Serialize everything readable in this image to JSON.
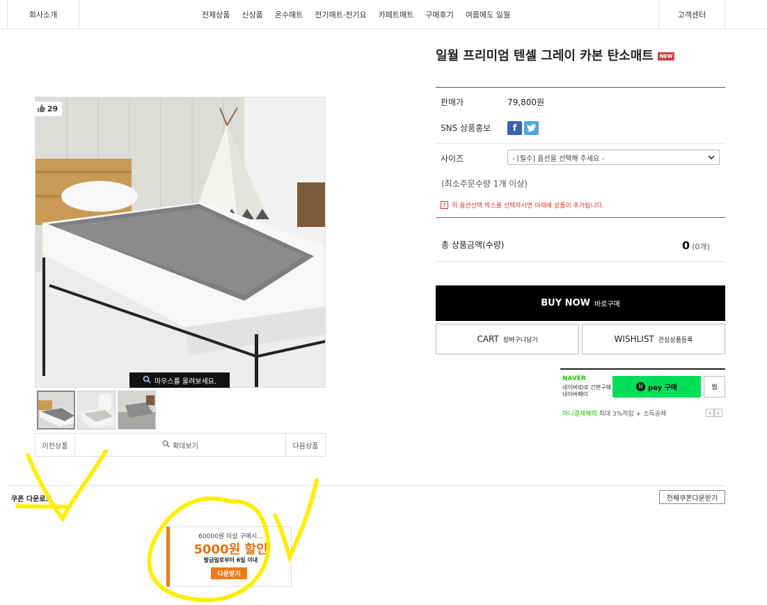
{
  "nav": {
    "company": "회사소개",
    "support": "고객센터",
    "menu": [
      "전체상품",
      "신상품",
      "온수매트",
      "전기매트·전기요",
      "카페트매트",
      "구매후기",
      "여름에도 일월"
    ]
  },
  "product": {
    "title": "일월 프리미엄 텐셀 그레이 카본 탄소매트",
    "new_badge": "NEW",
    "likes": "29",
    "zoom_hint": "마우스를 올려보세요.",
    "prev_label": "이전상품",
    "zoom_label": "확대보기",
    "next_label": "다음상품"
  },
  "info": {
    "price_label": "판매가",
    "price": "79,800원",
    "sns_label": "SNS 상품홍보",
    "size_label": "사이즈",
    "size_placeholder": "- [필수] 옵션을 선택해 주세요 -",
    "min_order": "(최소주문수량 1개 이상)",
    "warning": "위 옵션선택 박스를 선택하시면 아래에 상품이 추가됩니다.",
    "total_label": "총 상품금액(수량)",
    "total_value": "0",
    "total_count": "(0개)"
  },
  "buttons": {
    "buy_en": "BUY NOW",
    "buy_ko": "바로구매",
    "cart_en": "CART",
    "cart_ko": "장바구니담기",
    "wish_en": "WISHLIST",
    "wish_ko": "관심상품등록"
  },
  "naver": {
    "brand": "NAVER",
    "desc1": "네이버ID로 간편구매",
    "desc2": "네이버페이",
    "pay_label": "pay 구매",
    "zzim": "찜",
    "benefit_green": "머니결제혜택",
    "benefit_rest": "최대 3%적립 + 소득공제"
  },
  "coupon": {
    "section_title": "쿠폰 다운로드",
    "all_button": "전체쿠폰다운받기",
    "condition": "60000원 이상 구매시...",
    "discount": "5000원 할인",
    "validity": "발급일로부터 6일 이내",
    "download": "다운받기"
  },
  "colors": {
    "accent_orange": "#ef7a14",
    "naver_green": "#00de5a",
    "highlight_yellow": "#ffee00"
  }
}
